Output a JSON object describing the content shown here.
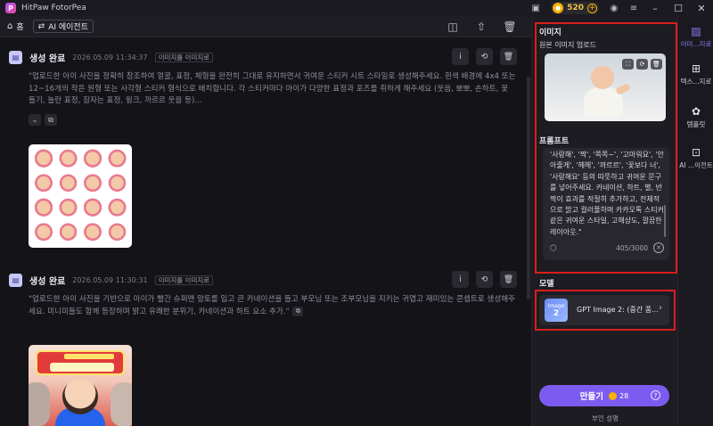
{
  "window": {
    "app_name": "HitPaw FotorPea",
    "credits": "520"
  },
  "toolbar": {
    "home_label": "홈",
    "mode_chip": "AI 에이전트"
  },
  "feed": {
    "cards": [
      {
        "status": "생성 완료",
        "timestamp": "2026.05.09   11:34:37",
        "tag": "이미지를 이미지로",
        "prompt": "\"업로드한 아이 사진을 정확히 참조하여 얼굴, 표정, 체형을 완전히 그대로 유지하면서 귀여운 스티커 시트 스타일로 생성해주세요. 흰색 배경에 4x4 또는 12~16개의 작은 원형 또는 사각형 스티커 형식으로 배치합니다. 각 스티커마다 아이가 다양한 표정과 포즈를 취하게 해주세요 (웃음, 뽀뽀, 손하트, 꽃 들기, 놀란 표정, 잠자는 표정, 윙크, 까르르 웃음 등)..."
      },
      {
        "status": "생성 완료",
        "timestamp": "2026.05.09   11:30:31",
        "tag": "이미지를 이미지로",
        "prompt": "\"업로드한 아이 사진을 기반으로 아이가 빨간 슈퍼맨 망토를 입고 큰 카네이션을 들고 부모님 또는 조부모님을 지키는 귀엽고 재미있는 콘셉트로 생성해주세요. 미니미들도 함께 등장하며 밝고 유쾌한 분위기, 카네이션과 하트 요소 추가.\""
      }
    ]
  },
  "panel": {
    "image_section_title": "이미지",
    "upload_label": "원본 이미지 업로드",
    "prompt_section_title": "프롬프트",
    "prompt_text": "'사랑해', '짝', '쪽쪽~', '고마워요', '안아줄게', '헤헤', '까르르', '꽃보다 너', '사랑해요' 등의 따뜻하고 귀여운 문구를 넣어주세요. 카네이션, 하트, 별, 반짝이 효과를 적절히 추가하고, 전체적으로 밝고 컬러풀하며 카카오톡 스티커 같은 귀여운 스타일, 고해상도, 깔끔한 레이아웃.\"",
    "char_count": "405/3000",
    "model_section_title": "모델",
    "model_thumb_top": "Image",
    "model_thumb_num": "2",
    "model_name": "GPT Image 2: (중간 품...",
    "generate_label": "만들기",
    "generate_cost": "28",
    "disclaimer": "부인 성명"
  },
  "rail": {
    "items": [
      {
        "label": "이미...지로",
        "icon": "image-icon"
      },
      {
        "label": "텍스...지로",
        "icon": "text-image-icon"
      },
      {
        "label": "템플릿",
        "icon": "template-icon"
      },
      {
        "label": "AI ...이전트",
        "icon": "agent-icon"
      }
    ]
  },
  "colors": {
    "accent": "#7c5cf0",
    "highlight_box": "#d81e1e",
    "coin": "#f5b400"
  }
}
